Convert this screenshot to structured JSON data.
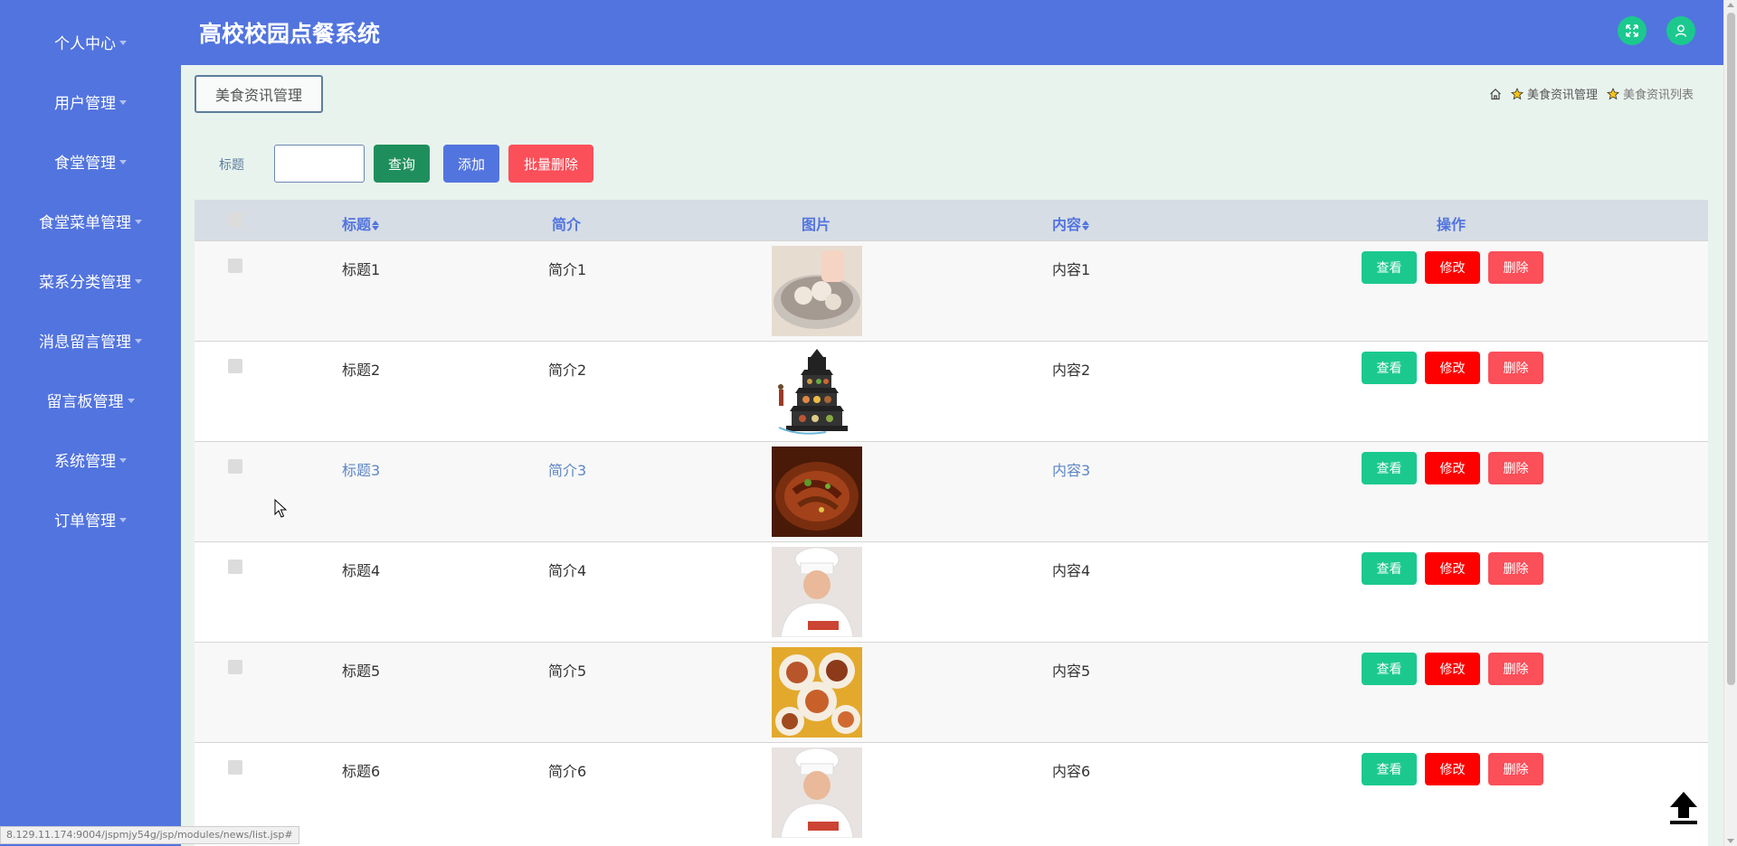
{
  "app": {
    "title": "高校校园点餐系统"
  },
  "colors": {
    "primary": "#5274df",
    "success": "#1bc98e",
    "danger": "#ff0000",
    "warning": "#fb4f59"
  },
  "sidebar": {
    "items": [
      {
        "label": "个人中心"
      },
      {
        "label": "用户管理"
      },
      {
        "label": "食堂管理"
      },
      {
        "label": "食堂菜单管理"
      },
      {
        "label": "菜系分类管理"
      },
      {
        "label": "消息留言管理"
      },
      {
        "label": "留言板管理"
      },
      {
        "label": "系统管理"
      },
      {
        "label": "订单管理"
      }
    ]
  },
  "header": {
    "icons": [
      {
        "name": "fullscreen-icon"
      },
      {
        "name": "user-icon"
      }
    ]
  },
  "page": {
    "tag": "美食资讯管理",
    "breadcrumb": [
      "美食资讯管理",
      "美食资讯列表"
    ]
  },
  "search": {
    "label": "标题",
    "value": "",
    "query_button": "查询",
    "add_button": "添加",
    "batch_delete_button": "批量删除"
  },
  "table": {
    "columns": [
      "标题",
      "简介",
      "图片",
      "内容",
      "操作"
    ],
    "rows": [
      {
        "title": "标题1",
        "intro": "简介1",
        "image": "dumpling-soup",
        "content": "内容1"
      },
      {
        "title": "标题2",
        "intro": "简介2",
        "image": "food-pagoda",
        "content": "内容2"
      },
      {
        "title": "标题3",
        "intro": "简介3",
        "image": "beef-dish",
        "content": "内容3"
      },
      {
        "title": "标题4",
        "intro": "简介4",
        "image": "chef",
        "content": "内容4"
      },
      {
        "title": "标题5",
        "intro": "简介5",
        "image": "plated-dishes",
        "content": "内容5"
      },
      {
        "title": "标题6",
        "intro": "简介6",
        "image": "chef",
        "content": "内容6"
      }
    ],
    "actions": {
      "view": "查看",
      "edit": "修改",
      "delete": "删除"
    }
  },
  "status_bar": {
    "url": "8.129.11.174:9004/jspmjy54g/jsp/modules/news/list.jsp#"
  }
}
